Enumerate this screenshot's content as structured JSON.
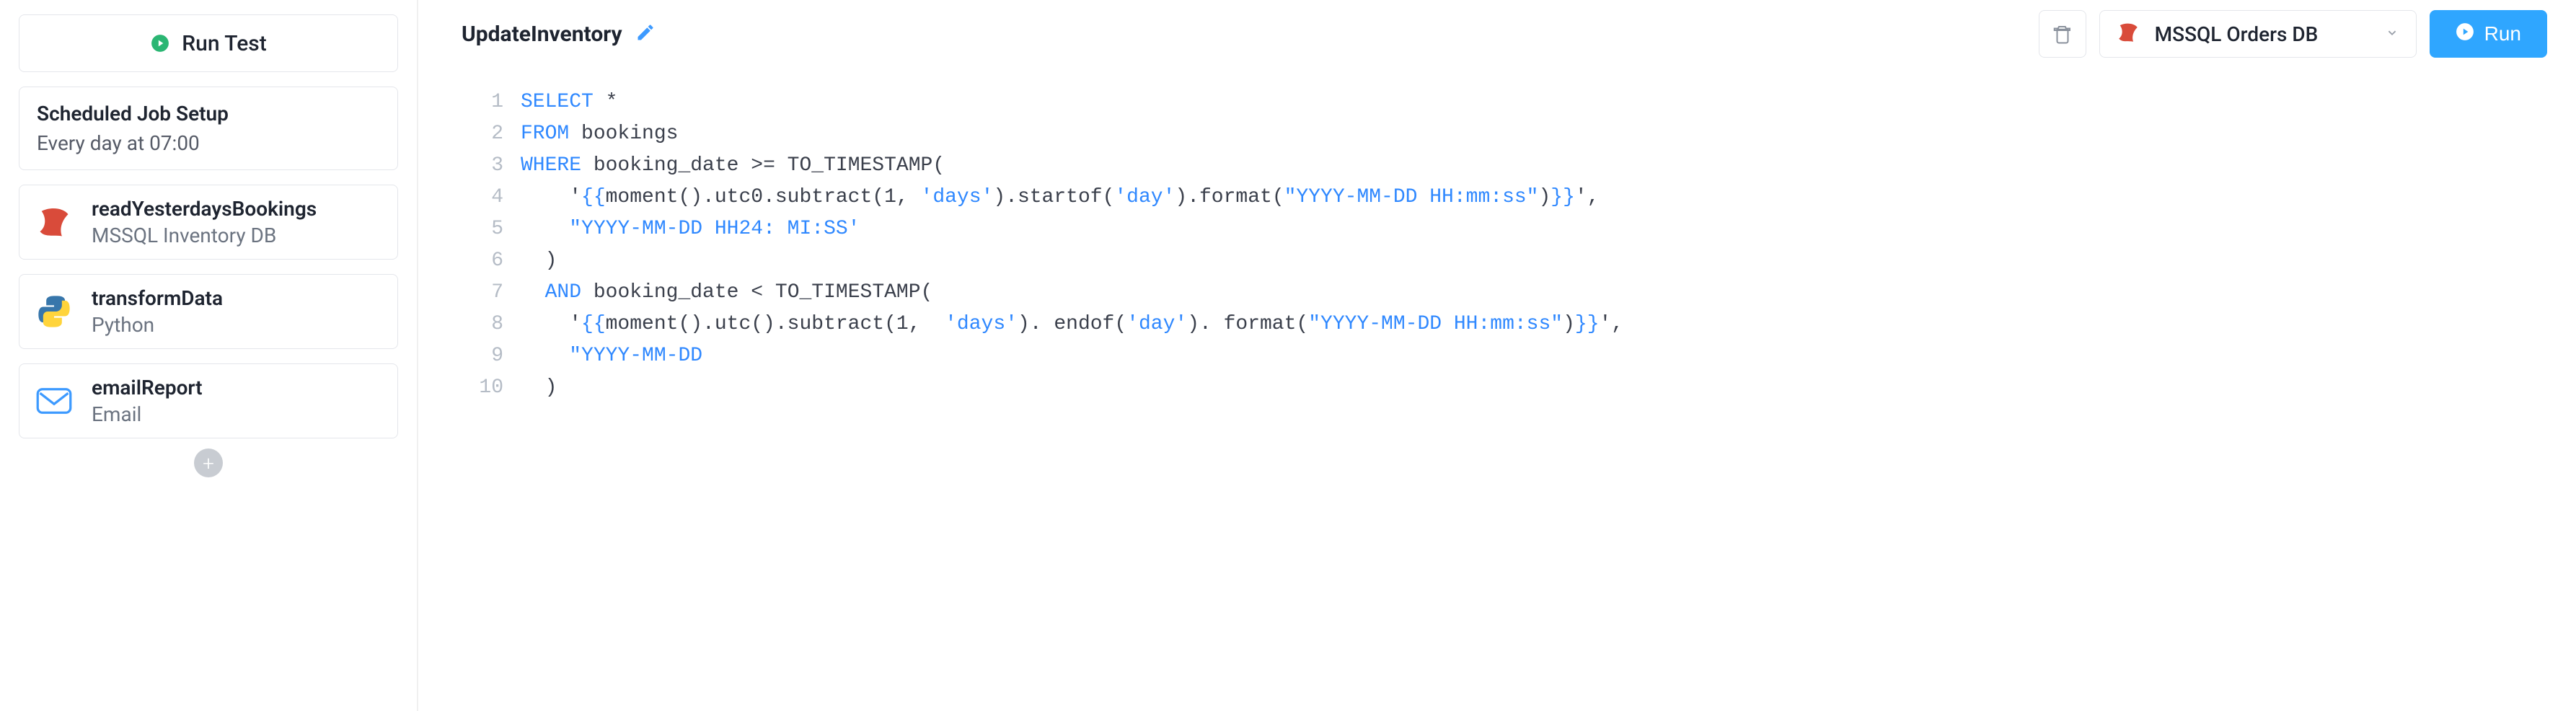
{
  "sidebar": {
    "run_test_label": "Run Test",
    "scheduled_job": {
      "title": "Scheduled Job Setup",
      "schedule": "Every day at 07:00"
    },
    "steps": [
      {
        "name": "readYesterdaysBookings",
        "subtitle": "MSSQL Inventory DB",
        "icon": "mssql"
      },
      {
        "name": "transformData",
        "subtitle": "Python",
        "icon": "python"
      },
      {
        "name": "emailReport",
        "subtitle": "Email",
        "icon": "email"
      }
    ],
    "add_label": "+"
  },
  "header": {
    "title": "UpdateInventory",
    "datasource_selected": "MSSQL Orders DB",
    "run_label": "Run"
  },
  "editor": {
    "lines": [
      {
        "n": 1,
        "tokens": [
          {
            "t": "SELECT",
            "c": "kw"
          },
          {
            "t": " ",
            "c": "pun"
          },
          {
            "t": "*",
            "c": "pun"
          }
        ]
      },
      {
        "n": 2,
        "tokens": [
          {
            "t": "FROM",
            "c": "kw"
          },
          {
            "t": " bookings",
            "c": "id"
          }
        ]
      },
      {
        "n": 3,
        "tokens": [
          {
            "t": "WHERE",
            "c": "kw"
          },
          {
            "t": " booking_date ",
            "c": "id"
          },
          {
            "t": ">=",
            "c": "pun"
          },
          {
            "t": " TO_TIMESTAMP(",
            "c": "id"
          }
        ]
      },
      {
        "n": 4,
        "tokens": [
          {
            "t": "    '",
            "c": "pun"
          },
          {
            "t": "{{",
            "c": "bind"
          },
          {
            "t": "moment().utc0.subtract(",
            "c": "id"
          },
          {
            "t": "1",
            "c": "num"
          },
          {
            "t": ", ",
            "c": "pun"
          },
          {
            "t": "'days'",
            "c": "str"
          },
          {
            "t": ").startof(",
            "c": "id"
          },
          {
            "t": "'day'",
            "c": "str"
          },
          {
            "t": ").format(",
            "c": "id"
          },
          {
            "t": "\"YYYY-MM-DD HH:mm:ss\"",
            "c": "str"
          },
          {
            "t": ")",
            "c": "id"
          },
          {
            "t": "}}",
            "c": "bind"
          },
          {
            "t": "',",
            "c": "pun"
          }
        ]
      },
      {
        "n": 5,
        "tokens": [
          {
            "t": "    ",
            "c": "pun"
          },
          {
            "t": "\"YYYY-MM-DD HH24: MI:SS'",
            "c": "str"
          }
        ]
      },
      {
        "n": 6,
        "tokens": [
          {
            "t": "  )",
            "c": "pun"
          }
        ]
      },
      {
        "n": 7,
        "tokens": [
          {
            "t": "  ",
            "c": "pun"
          },
          {
            "t": "AND",
            "c": "kw"
          },
          {
            "t": " booking_date ",
            "c": "id"
          },
          {
            "t": "<",
            "c": "pun"
          },
          {
            "t": " TO_TIMESTAMP(",
            "c": "id"
          }
        ]
      },
      {
        "n": 8,
        "tokens": [
          {
            "t": "    '",
            "c": "pun"
          },
          {
            "t": "{{",
            "c": "bind"
          },
          {
            "t": "moment().utc().subtract(",
            "c": "id"
          },
          {
            "t": "1",
            "c": "num"
          },
          {
            "t": ", ",
            "c": "pun"
          },
          {
            "t": " 'days'",
            "c": "str"
          },
          {
            "t": "). endof(",
            "c": "id"
          },
          {
            "t": "'day'",
            "c": "str"
          },
          {
            "t": "). format(",
            "c": "id"
          },
          {
            "t": "\"YYYY-MM-DD HH:mm:ss\"",
            "c": "str"
          },
          {
            "t": ")",
            "c": "id"
          },
          {
            "t": "}}",
            "c": "bind"
          },
          {
            "t": "',",
            "c": "pun"
          }
        ]
      },
      {
        "n": 9,
        "tokens": [
          {
            "t": "    ",
            "c": "pun"
          },
          {
            "t": "\"YYYY-MM-DD",
            "c": "str"
          }
        ]
      },
      {
        "n": 10,
        "tokens": [
          {
            "t": "  )",
            "c": "pun"
          }
        ]
      }
    ]
  }
}
